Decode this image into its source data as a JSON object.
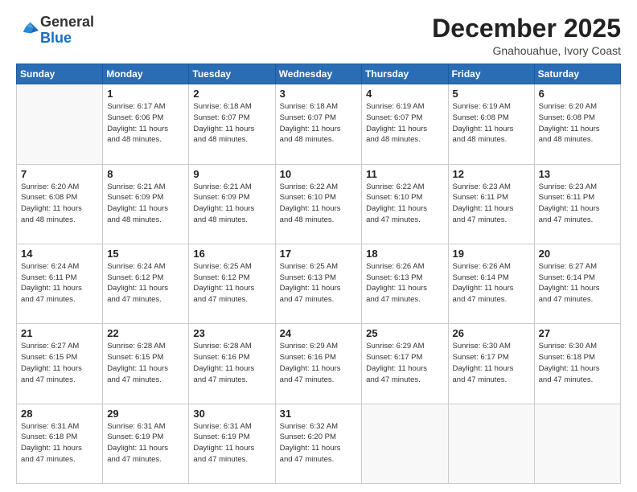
{
  "header": {
    "logo_line1": "General",
    "logo_line2": "Blue",
    "month": "December 2025",
    "location": "Gnahouahue, Ivory Coast"
  },
  "days_of_week": [
    "Sunday",
    "Monday",
    "Tuesday",
    "Wednesday",
    "Thursday",
    "Friday",
    "Saturday"
  ],
  "weeks": [
    [
      {
        "day": "",
        "info": ""
      },
      {
        "day": "1",
        "info": "Sunrise: 6:17 AM\nSunset: 6:06 PM\nDaylight: 11 hours\nand 48 minutes."
      },
      {
        "day": "2",
        "info": "Sunrise: 6:18 AM\nSunset: 6:07 PM\nDaylight: 11 hours\nand 48 minutes."
      },
      {
        "day": "3",
        "info": "Sunrise: 6:18 AM\nSunset: 6:07 PM\nDaylight: 11 hours\nand 48 minutes."
      },
      {
        "day": "4",
        "info": "Sunrise: 6:19 AM\nSunset: 6:07 PM\nDaylight: 11 hours\nand 48 minutes."
      },
      {
        "day": "5",
        "info": "Sunrise: 6:19 AM\nSunset: 6:08 PM\nDaylight: 11 hours\nand 48 minutes."
      },
      {
        "day": "6",
        "info": "Sunrise: 6:20 AM\nSunset: 6:08 PM\nDaylight: 11 hours\nand 48 minutes."
      }
    ],
    [
      {
        "day": "7",
        "info": "Sunrise: 6:20 AM\nSunset: 6:08 PM\nDaylight: 11 hours\nand 48 minutes."
      },
      {
        "day": "8",
        "info": "Sunrise: 6:21 AM\nSunset: 6:09 PM\nDaylight: 11 hours\nand 48 minutes."
      },
      {
        "day": "9",
        "info": "Sunrise: 6:21 AM\nSunset: 6:09 PM\nDaylight: 11 hours\nand 48 minutes."
      },
      {
        "day": "10",
        "info": "Sunrise: 6:22 AM\nSunset: 6:10 PM\nDaylight: 11 hours\nand 48 minutes."
      },
      {
        "day": "11",
        "info": "Sunrise: 6:22 AM\nSunset: 6:10 PM\nDaylight: 11 hours\nand 47 minutes."
      },
      {
        "day": "12",
        "info": "Sunrise: 6:23 AM\nSunset: 6:11 PM\nDaylight: 11 hours\nand 47 minutes."
      },
      {
        "day": "13",
        "info": "Sunrise: 6:23 AM\nSunset: 6:11 PM\nDaylight: 11 hours\nand 47 minutes."
      }
    ],
    [
      {
        "day": "14",
        "info": "Sunrise: 6:24 AM\nSunset: 6:11 PM\nDaylight: 11 hours\nand 47 minutes."
      },
      {
        "day": "15",
        "info": "Sunrise: 6:24 AM\nSunset: 6:12 PM\nDaylight: 11 hours\nand 47 minutes."
      },
      {
        "day": "16",
        "info": "Sunrise: 6:25 AM\nSunset: 6:12 PM\nDaylight: 11 hours\nand 47 minutes."
      },
      {
        "day": "17",
        "info": "Sunrise: 6:25 AM\nSunset: 6:13 PM\nDaylight: 11 hours\nand 47 minutes."
      },
      {
        "day": "18",
        "info": "Sunrise: 6:26 AM\nSunset: 6:13 PM\nDaylight: 11 hours\nand 47 minutes."
      },
      {
        "day": "19",
        "info": "Sunrise: 6:26 AM\nSunset: 6:14 PM\nDaylight: 11 hours\nand 47 minutes."
      },
      {
        "day": "20",
        "info": "Sunrise: 6:27 AM\nSunset: 6:14 PM\nDaylight: 11 hours\nand 47 minutes."
      }
    ],
    [
      {
        "day": "21",
        "info": "Sunrise: 6:27 AM\nSunset: 6:15 PM\nDaylight: 11 hours\nand 47 minutes."
      },
      {
        "day": "22",
        "info": "Sunrise: 6:28 AM\nSunset: 6:15 PM\nDaylight: 11 hours\nand 47 minutes."
      },
      {
        "day": "23",
        "info": "Sunrise: 6:28 AM\nSunset: 6:16 PM\nDaylight: 11 hours\nand 47 minutes."
      },
      {
        "day": "24",
        "info": "Sunrise: 6:29 AM\nSunset: 6:16 PM\nDaylight: 11 hours\nand 47 minutes."
      },
      {
        "day": "25",
        "info": "Sunrise: 6:29 AM\nSunset: 6:17 PM\nDaylight: 11 hours\nand 47 minutes."
      },
      {
        "day": "26",
        "info": "Sunrise: 6:30 AM\nSunset: 6:17 PM\nDaylight: 11 hours\nand 47 minutes."
      },
      {
        "day": "27",
        "info": "Sunrise: 6:30 AM\nSunset: 6:18 PM\nDaylight: 11 hours\nand 47 minutes."
      }
    ],
    [
      {
        "day": "28",
        "info": "Sunrise: 6:31 AM\nSunset: 6:18 PM\nDaylight: 11 hours\nand 47 minutes."
      },
      {
        "day": "29",
        "info": "Sunrise: 6:31 AM\nSunset: 6:19 PM\nDaylight: 11 hours\nand 47 minutes."
      },
      {
        "day": "30",
        "info": "Sunrise: 6:31 AM\nSunset: 6:19 PM\nDaylight: 11 hours\nand 47 minutes."
      },
      {
        "day": "31",
        "info": "Sunrise: 6:32 AM\nSunset: 6:20 PM\nDaylight: 11 hours\nand 47 minutes."
      },
      {
        "day": "",
        "info": ""
      },
      {
        "day": "",
        "info": ""
      },
      {
        "day": "",
        "info": ""
      }
    ]
  ]
}
